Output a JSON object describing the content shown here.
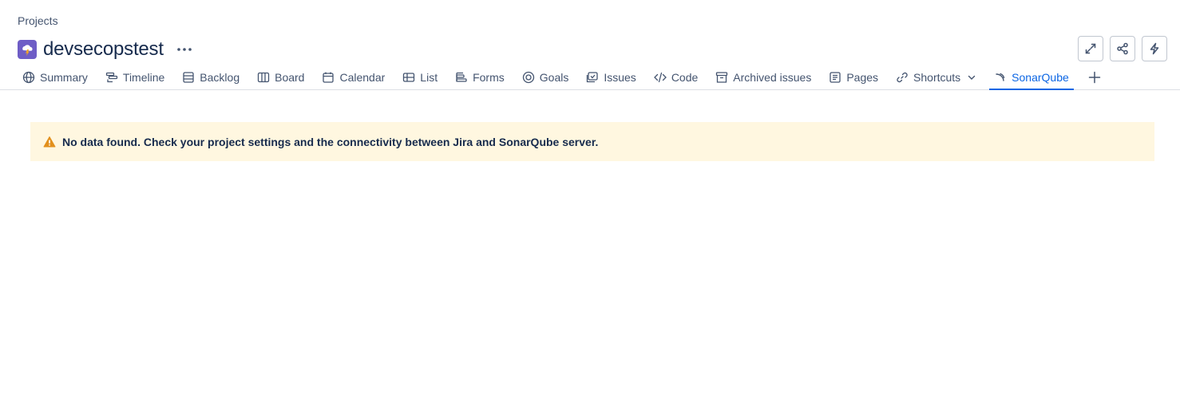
{
  "breadcrumb": "Projects",
  "project": {
    "title": "devsecopstest",
    "avatar_icon": "project-avatar-icon",
    "avatar_color": "#6e5dc6"
  },
  "header_actions": [
    {
      "name": "expand-button",
      "icon": "expand-icon"
    },
    {
      "name": "share-button",
      "icon": "share-icon"
    },
    {
      "name": "automation-button",
      "icon": "lightning-icon"
    }
  ],
  "tabs": [
    {
      "label": "Summary",
      "icon": "globe-icon"
    },
    {
      "label": "Timeline",
      "icon": "timeline-icon"
    },
    {
      "label": "Backlog",
      "icon": "backlog-icon"
    },
    {
      "label": "Board",
      "icon": "board-icon"
    },
    {
      "label": "Calendar",
      "icon": "calendar-icon"
    },
    {
      "label": "List",
      "icon": "list-icon"
    },
    {
      "label": "Forms",
      "icon": "forms-icon"
    },
    {
      "label": "Goals",
      "icon": "goals-icon"
    },
    {
      "label": "Issues",
      "icon": "issues-icon"
    },
    {
      "label": "Code",
      "icon": "code-icon"
    },
    {
      "label": "Archived issues",
      "icon": "archive-icon"
    },
    {
      "label": "Pages",
      "icon": "pages-icon"
    },
    {
      "label": "Shortcuts",
      "icon": "link-icon"
    },
    {
      "label": "SonarQube",
      "icon": "sonarqube-icon"
    }
  ],
  "active_tab": "SonarQube",
  "alert": {
    "text": "No data found. Check your project settings and the connectivity between Jira and SonarQube server.",
    "icon": "warning-icon",
    "background": "#fff7e0",
    "icon_color": "#e2901d"
  },
  "colors": {
    "accent": "#0c66e4",
    "text": "#172b4d",
    "subtle_text": "#44546f"
  }
}
